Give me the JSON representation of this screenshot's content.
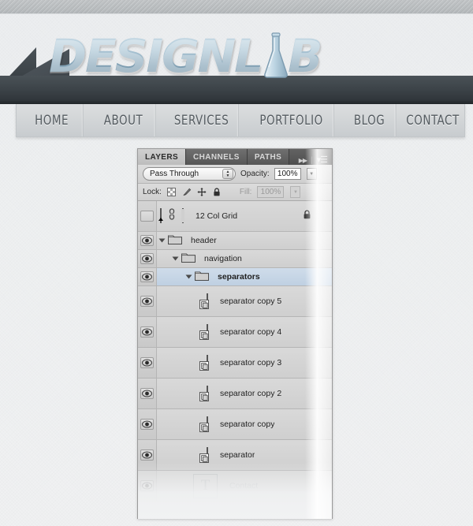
{
  "site": {
    "logo": {
      "text_part1": "DESIGNL",
      "text_part2": "B",
      "flask_icon": "flask-icon",
      "alt": "DESIGNLAB"
    },
    "nav": [
      {
        "label": "HOME",
        "name": "nav-item-home"
      },
      {
        "label": "ABOUT",
        "name": "nav-item-about"
      },
      {
        "label": "SERVICES",
        "name": "nav-item-services"
      },
      {
        "label": "PORTFOLIO",
        "name": "nav-item-portfolio"
      },
      {
        "label": "BLOG",
        "name": "nav-item-blog"
      },
      {
        "label": "CONTACT",
        "name": "nav-item-contact"
      }
    ]
  },
  "panel": {
    "tabs": [
      {
        "label": "LAYERS",
        "active": true
      },
      {
        "label": "CHANNELS",
        "active": false
      },
      {
        "label": "PATHS",
        "active": false
      }
    ],
    "collapse_icon": "▶▶",
    "menu_icon": "▾☰",
    "blend_mode": "Pass Through",
    "opacity_label": "Opacity:",
    "opacity_value": "100%",
    "lock_label": "Lock:",
    "lock_icons": [
      "lock-transparency-icon",
      "lock-pixels-icon",
      "lock-position-icon",
      "lock-all-icon"
    ],
    "fill_label": "Fill:",
    "fill_value": "100%",
    "layers": [
      {
        "name": "12 Col Grid",
        "type": "adjustment",
        "visible": false,
        "indent": 0,
        "selected": false,
        "locked": true,
        "faded": false
      },
      {
        "name": "header",
        "type": "group",
        "visible": true,
        "indent": 0,
        "selected": false,
        "locked": false,
        "faded": false
      },
      {
        "name": "navigation",
        "type": "group",
        "visible": true,
        "indent": 1,
        "selected": false,
        "locked": false,
        "faded": false
      },
      {
        "name": "separators",
        "type": "group",
        "visible": true,
        "indent": 2,
        "selected": true,
        "locked": false,
        "faded": false
      },
      {
        "name": "separator copy 5",
        "type": "smart",
        "visible": true,
        "indent": 3,
        "selected": false,
        "locked": false,
        "faded": false
      },
      {
        "name": "separator copy 4",
        "type": "smart",
        "visible": true,
        "indent": 3,
        "selected": false,
        "locked": false,
        "faded": false
      },
      {
        "name": "separator copy 3",
        "type": "smart",
        "visible": true,
        "indent": 3,
        "selected": false,
        "locked": false,
        "faded": false
      },
      {
        "name": "separator copy 2",
        "type": "smart",
        "visible": true,
        "indent": 3,
        "selected": false,
        "locked": false,
        "faded": false
      },
      {
        "name": "separator copy",
        "type": "smart",
        "visible": true,
        "indent": 3,
        "selected": false,
        "locked": false,
        "faded": false
      },
      {
        "name": "separator",
        "type": "smart",
        "visible": true,
        "indent": 3,
        "selected": false,
        "locked": false,
        "faded": false
      },
      {
        "name": "Contact",
        "type": "text",
        "visible": true,
        "indent": 2,
        "selected": false,
        "locked": false,
        "faded": true
      }
    ]
  },
  "colors": {
    "accent_blue": "#93b2c4",
    "header_dark": "#3d4449",
    "nav_bg": "#d2d5d7",
    "panel_bg": "#d6d6d6",
    "selected_row": "#c6d6e6",
    "thumb_red": "#ff0000"
  }
}
